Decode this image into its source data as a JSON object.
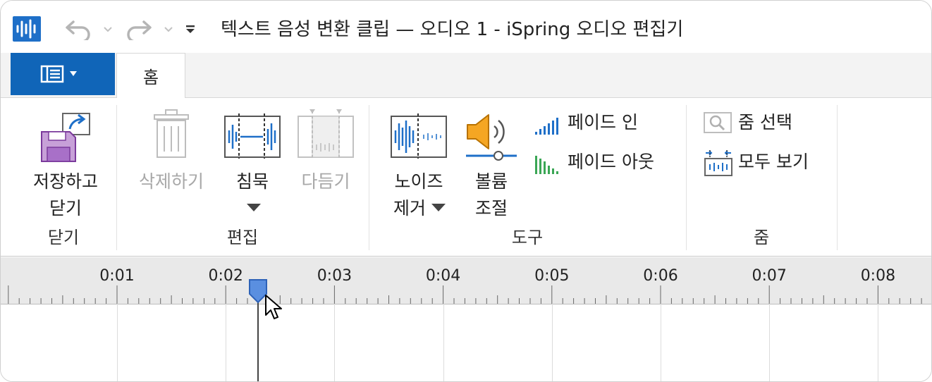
{
  "titlebar": {
    "title": "텍스트 음성 변환 클립 — 오디오  1 - iSpring 오디오 편집기",
    "icons": [
      "audio-wave-icon",
      "undo-icon",
      "redo-icon",
      "customize-quick-access-icon"
    ]
  },
  "tabs": {
    "home": "홈"
  },
  "ribbon": {
    "close_group": {
      "label": "닫기",
      "save_close_line1": "저장하고",
      "save_close_line2": "닫기"
    },
    "edit_group": {
      "label": "편집",
      "delete": "삭제하기",
      "silence": "침묵",
      "trim": "다듬기"
    },
    "tools_group": {
      "label": "도구",
      "noise_line1": "노이즈",
      "noise_line2": "제거",
      "volume_line1": "볼륨",
      "volume_line2": "조절",
      "fade_in": "페이드 인",
      "fade_out": "페이드 아웃"
    },
    "zoom_group": {
      "label": "줌",
      "zoom_selection": "줌 선택",
      "fit_all": "모두 보기"
    }
  },
  "timeline": {
    "ticks": [
      "0:01",
      "0:02",
      "0:03",
      "0:04",
      "0:05",
      "0:06",
      "0:07",
      "0:08"
    ],
    "playhead_time_seconds": 2.3
  },
  "colors": {
    "accent": "#1065b8",
    "speaker": "#f5a623",
    "fade_in": "#1e6fc8",
    "fade_out": "#3aa655"
  }
}
